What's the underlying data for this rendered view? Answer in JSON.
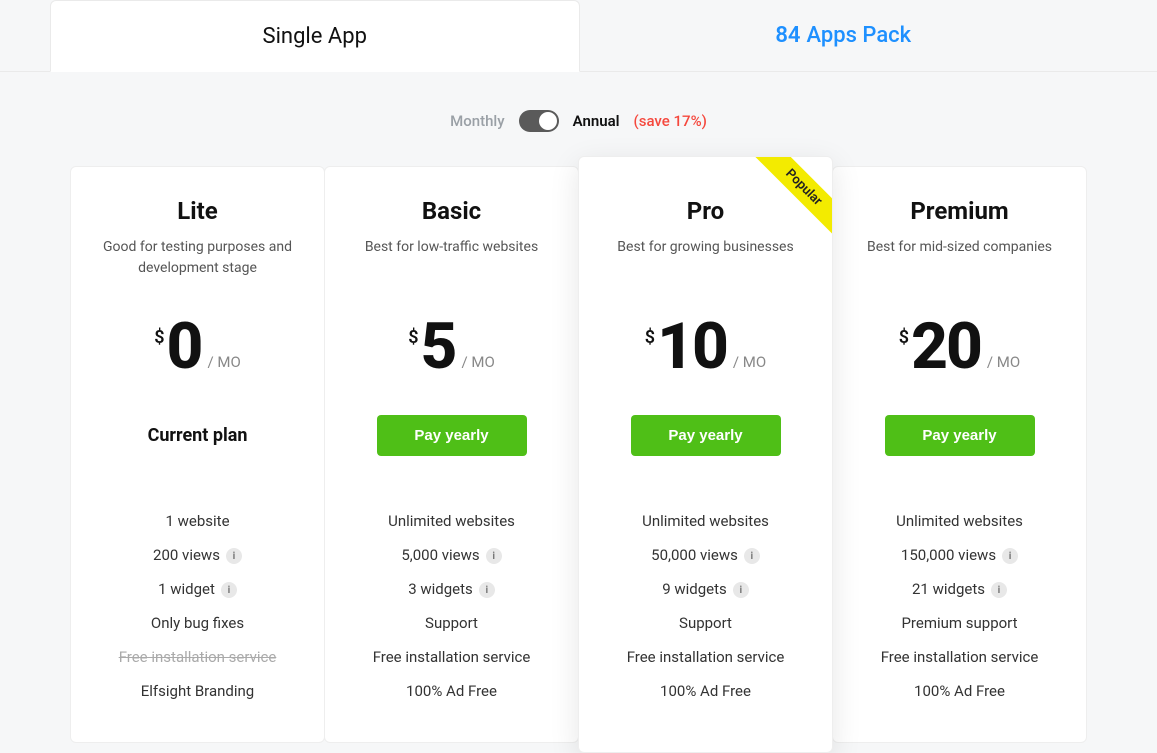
{
  "tabs": {
    "single_label": "Single App",
    "pack_count": "84",
    "pack_label": "Apps Pack"
  },
  "billing": {
    "monthly_label": "Monthly",
    "annual_label": "Annual",
    "save_note": "(save 17%)"
  },
  "common": {
    "period": "/ MO",
    "currency": "$",
    "info_glyph": "i"
  },
  "plans": [
    {
      "name": "Lite",
      "desc": "Good for testing purposes and development stage",
      "price": "0",
      "cta": "Current plan",
      "cta_kind": "label",
      "highlight": false,
      "ribbon": "",
      "features": [
        {
          "text": "1 website",
          "info": false,
          "strike": false
        },
        {
          "text": "200 views",
          "info": true,
          "strike": false
        },
        {
          "text": "1 widget",
          "info": true,
          "strike": false
        },
        {
          "text": "Only bug fixes",
          "info": false,
          "strike": false
        },
        {
          "text": "Free installation service",
          "info": false,
          "strike": true
        },
        {
          "text": "Elfsight Branding",
          "info": false,
          "strike": false
        }
      ]
    },
    {
      "name": "Basic",
      "desc": "Best for low-traffic websites",
      "price": "5",
      "cta": "Pay yearly",
      "cta_kind": "button",
      "highlight": false,
      "ribbon": "",
      "features": [
        {
          "text": "Unlimited websites",
          "info": false,
          "strike": false
        },
        {
          "text": "5,000 views",
          "info": true,
          "strike": false
        },
        {
          "text": "3 widgets",
          "info": true,
          "strike": false
        },
        {
          "text": "Support",
          "info": false,
          "strike": false
        },
        {
          "text": "Free installation service",
          "info": false,
          "strike": false
        },
        {
          "text": "100% Ad Free",
          "info": false,
          "strike": false
        }
      ]
    },
    {
      "name": "Pro",
      "desc": "Best for growing businesses",
      "price": "10",
      "cta": "Pay yearly",
      "cta_kind": "button",
      "highlight": true,
      "ribbon": "Popular",
      "features": [
        {
          "text": "Unlimited websites",
          "info": false,
          "strike": false
        },
        {
          "text": "50,000 views",
          "info": true,
          "strike": false
        },
        {
          "text": "9 widgets",
          "info": true,
          "strike": false
        },
        {
          "text": "Support",
          "info": false,
          "strike": false
        },
        {
          "text": "Free installation service",
          "info": false,
          "strike": false
        },
        {
          "text": "100% Ad Free",
          "info": false,
          "strike": false
        }
      ]
    },
    {
      "name": "Premium",
      "desc": "Best for mid-sized companies",
      "price": "20",
      "cta": "Pay yearly",
      "cta_kind": "button",
      "highlight": false,
      "ribbon": "",
      "features": [
        {
          "text": "Unlimited websites",
          "info": false,
          "strike": false
        },
        {
          "text": "150,000 views",
          "info": true,
          "strike": false
        },
        {
          "text": "21 widgets",
          "info": true,
          "strike": false
        },
        {
          "text": "Premium support",
          "info": false,
          "strike": false
        },
        {
          "text": "Free installation service",
          "info": false,
          "strike": false
        },
        {
          "text": "100% Ad Free",
          "info": false,
          "strike": false
        }
      ]
    }
  ]
}
